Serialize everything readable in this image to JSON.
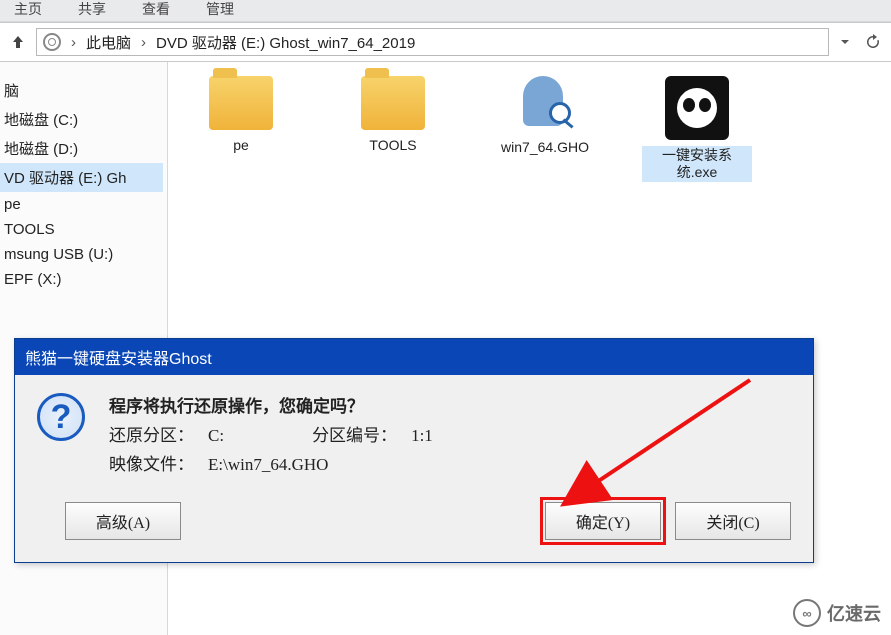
{
  "tabbar": {
    "t1": "主页",
    "t2": "共享",
    "t3": "查看",
    "t4": "管理"
  },
  "breadcrumb": {
    "seg1": "此电脑",
    "seg2": "DVD 驱动器 (E:) Ghost_win7_64_2019"
  },
  "sidebar": {
    "items": [
      {
        "label": "脑"
      },
      {
        "label": "地磁盘 (C:)"
      },
      {
        "label": "地磁盘 (D:)"
      },
      {
        "label": "VD 驱动器 (E:) Gh"
      },
      {
        "label": "pe"
      },
      {
        "label": "TOOLS"
      },
      {
        "label": "msung USB (U:)"
      },
      {
        "label": "EPF (X:)"
      }
    ]
  },
  "files": [
    {
      "label": "pe",
      "type": "folder"
    },
    {
      "label": "TOOLS",
      "type": "folder"
    },
    {
      "label": "win7_64.GHO",
      "type": "gho"
    },
    {
      "label": "一键安装系统.exe",
      "type": "panda"
    }
  ],
  "dialog": {
    "title": "熊猫一键硬盘安装器Ghost",
    "prompt": "程序将执行还原操作，您确定吗？",
    "row1_label": "还原分区：",
    "row1_val": "C:",
    "row1b_label": "分区编号：",
    "row1b_val": "1:1",
    "row2_label": "映像文件：",
    "row2_val": "E:\\win7_64.GHO",
    "btn_adv": "高级(A)",
    "btn_ok": "确定(Y)",
    "btn_close": "关闭(C)"
  },
  "watermark": {
    "text": "亿速云"
  }
}
